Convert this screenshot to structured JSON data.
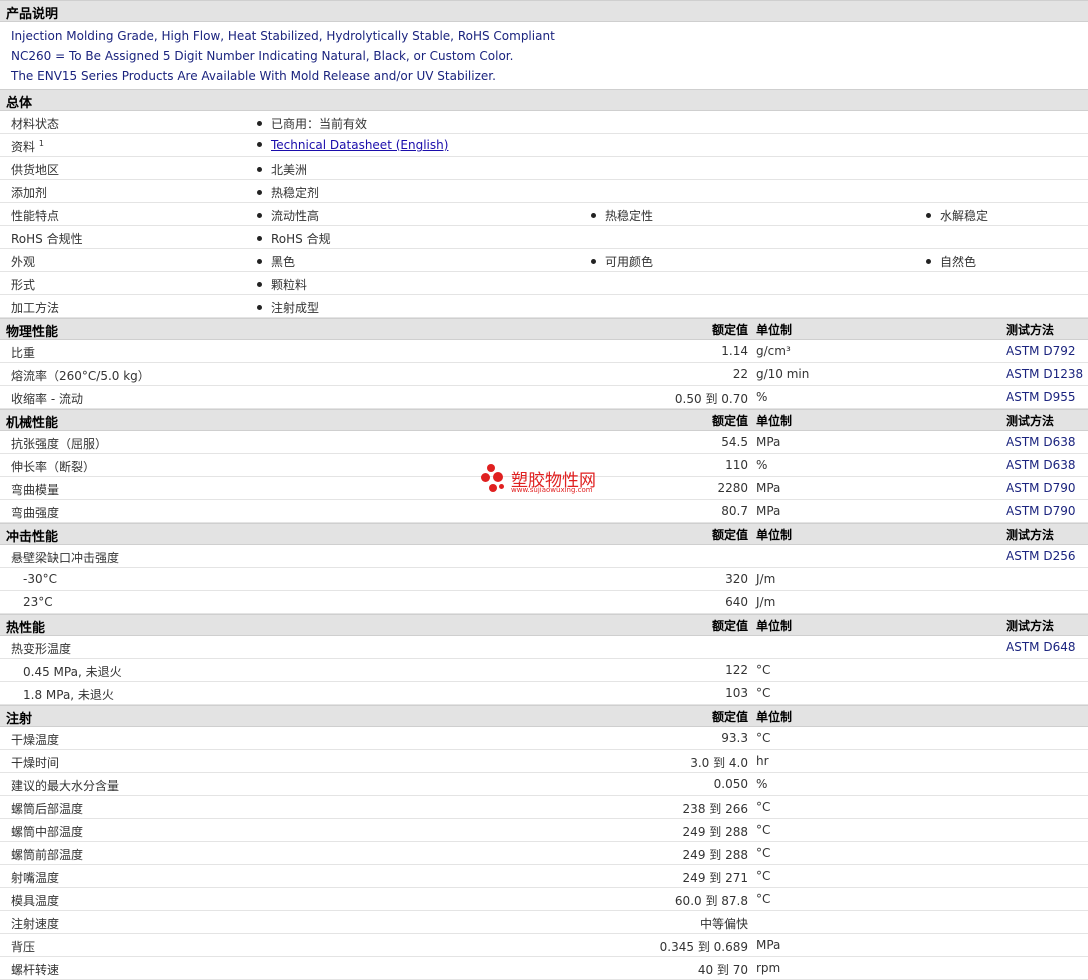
{
  "sections": {
    "desc": {
      "title": "产品说明",
      "lines": [
        "Injection Molding Grade, High Flow, Heat Stabilized, Hydrolytically Stable, RoHS Compliant",
        "NC260 = To Be Assigned 5 Digit Number Indicating Natural, Black, or Custom Color.",
        "The ENV15 Series Products Are Available With Mold Release and/or UV Stabilizer."
      ]
    },
    "general": {
      "title": "总体"
    },
    "physical": {
      "title": "物理性能"
    },
    "mechanical": {
      "title": "机械性能"
    },
    "impact": {
      "title": "冲击性能"
    },
    "thermal": {
      "title": "热性能"
    },
    "injection": {
      "title": "注射"
    }
  },
  "headers": {
    "nominal": "额定值",
    "unit": "单位制",
    "test": "测试方法"
  },
  "general": {
    "status_label": "材料状态",
    "status_value": "已商用：当前有效",
    "docs_label": "资料",
    "docs_sup": "1",
    "docs_link": "Technical Datasheet (English)",
    "region_label": "供货地区",
    "region_value": "北美洲",
    "additive_label": "添加剂",
    "additive_value": "热稳定剂",
    "features_label": "性能特点",
    "features": [
      "流动性高",
      "热稳定性",
      "水解稳定"
    ],
    "rohs_label": "RoHS 合规性",
    "rohs_value": "RoHS 合规",
    "appearance_label": "外观",
    "appearance": [
      "黑色",
      "可用颜色",
      "自然色"
    ],
    "form_label": "形式",
    "form_value": "颗粒料",
    "process_label": "加工方法",
    "process_value": "注射成型"
  },
  "physical": [
    {
      "label": "比重",
      "value": "1.14",
      "unit": "g/cm³",
      "test": "ASTM D792"
    },
    {
      "label": "熔流率（260°C/5.0 kg）",
      "value": "22",
      "unit": "g/10 min",
      "test": "ASTM D1238"
    },
    {
      "label": "收缩率 - 流动",
      "value": "0.50 到  0.70",
      "unit": "%",
      "test": "ASTM D955"
    }
  ],
  "mechanical": [
    {
      "label": "抗张强度（屈服）",
      "value": "54.5",
      "unit": "MPa",
      "test": "ASTM D638"
    },
    {
      "label": "伸长率（断裂）",
      "value": "110",
      "unit": "%",
      "test": "ASTM D638"
    },
    {
      "label": "弯曲模量",
      "value": "2280",
      "unit": "MPa",
      "test": "ASTM D790"
    },
    {
      "label": "弯曲强度",
      "value": "80.7",
      "unit": "MPa",
      "test": "ASTM D790"
    }
  ],
  "impact": {
    "head_label": "悬壁梁缺口冲击强度",
    "head_test": "ASTM D256",
    "rows": [
      {
        "label": "-30°C",
        "value": "320",
        "unit": "J/m"
      },
      {
        "label": "23°C",
        "value": "640",
        "unit": "J/m"
      }
    ]
  },
  "thermal": {
    "head_label": "热变形温度",
    "head_test": "ASTM D648",
    "rows": [
      {
        "label": "0.45 MPa, 未退火",
        "value": "122",
        "unit": "°C"
      },
      {
        "label": "1.8 MPa, 未退火",
        "value": "103",
        "unit": "°C"
      }
    ]
  },
  "injection": [
    {
      "label": "干燥温度",
      "value": "93.3",
      "unit": "°C"
    },
    {
      "label": "干燥时间",
      "value": "3.0 到  4.0",
      "unit": "hr"
    },
    {
      "label": "建议的最大水分含量",
      "value": "0.050",
      "unit": "%"
    },
    {
      "label": "螺筒后部温度",
      "value": "238 到  266",
      "unit": "°C"
    },
    {
      "label": "螺筒中部温度",
      "value": "249 到  288",
      "unit": "°C"
    },
    {
      "label": "螺筒前部温度",
      "value": "249 到  288",
      "unit": "°C"
    },
    {
      "label": "射嘴温度",
      "value": "249 到  271",
      "unit": "°C"
    },
    {
      "label": "模具温度",
      "value": "60.0 到  87.8",
      "unit": "°C"
    },
    {
      "label": "注射速度",
      "value": "中等偏快",
      "unit": ""
    },
    {
      "label": "背压",
      "value": "0.345 到  0.689",
      "unit": "MPa"
    },
    {
      "label": "螺杆转速",
      "value": "40 到  70",
      "unit": "rpm"
    }
  ],
  "watermark": {
    "text": "塑胶物性网",
    "url": "www.sujiaowuxing.com",
    "color": "#e02020"
  }
}
